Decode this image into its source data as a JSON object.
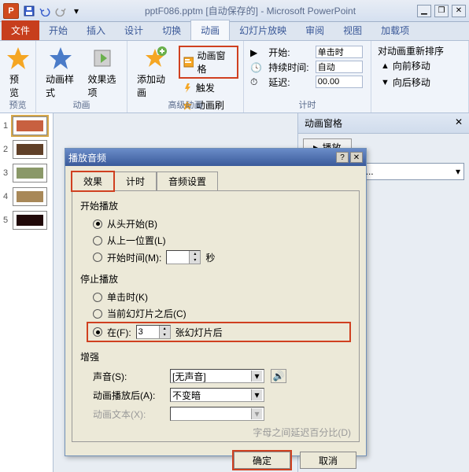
{
  "title": "pptF086.pptm [自动保存的] - Microsoft PowerPoint",
  "app_letter": "P",
  "tabs": {
    "file": "文件",
    "home": "开始",
    "insert": "插入",
    "design": "设计",
    "transitions": "切换",
    "animations": "动画",
    "slideshow": "幻灯片放映",
    "review": "审阅",
    "view": "视图",
    "addins": "加载项"
  },
  "ribbon": {
    "preview": "预览",
    "preview_group": "预览",
    "anim_styles": "动画样式",
    "effect_options": "效果选项",
    "anim_group": "动画",
    "add_anim": "添加动画",
    "anim_pane": "动画窗格",
    "trigger": "触发",
    "anim_painter": "动画刷",
    "adv_group": "高级动画",
    "start_label": "开始:",
    "start_value": "单击时",
    "duration_label": "持续时间:",
    "duration_value": "自动",
    "delay_label": "延迟:",
    "delay_value": "00.00",
    "timing_group": "计时",
    "reorder_title": "对动画重新排序",
    "move_earlier": "向前移动",
    "move_later": "向后移动"
  },
  "pane": {
    "title": "动画窗格",
    "play": "播放",
    "item": "ows In You ..."
  },
  "slides": [
    "1",
    "2",
    "3",
    "4",
    "5"
  ],
  "dialog": {
    "title": "播放音频",
    "tabs": {
      "effect": "效果",
      "timing": "计时",
      "audio": "音频设置"
    },
    "start_section": "开始播放",
    "from_begin": "从头开始(B)",
    "from_last": "从上一位置(L)",
    "start_time": "开始时间(M):",
    "seconds": "秒",
    "stop_section": "停止播放",
    "on_click": "单击时(K)",
    "after_current": "当前幻灯片之后(C)",
    "at": "在(F):",
    "at_value": "3",
    "slides_after": "张幻灯片后",
    "enhance": "增强",
    "sound": "声音(S):",
    "sound_value": "[无声音]",
    "after_anim": "动画播放后(A):",
    "after_anim_value": "不变暗",
    "anim_text": "动画文本(X):",
    "letter_delay": "字母之间延迟百分比(D)",
    "ok": "确定",
    "cancel": "取消"
  }
}
